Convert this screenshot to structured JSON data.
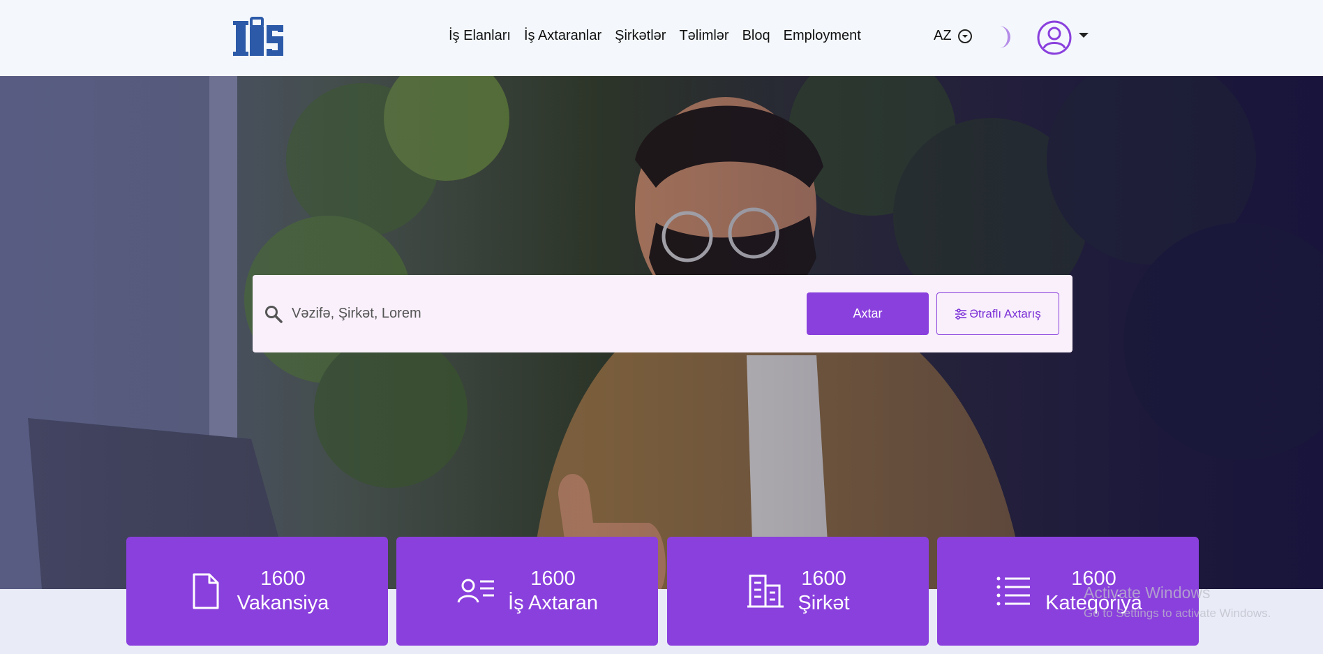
{
  "header": {
    "logo_alt": "İŞ",
    "nav": [
      "İş Elanları",
      "İş Axtaranlar",
      "Şirkətlər",
      "Təlimlər",
      "Bloq",
      "Employment"
    ],
    "language": "AZ"
  },
  "search": {
    "placeholder": "Vəzifə, Şirkət, Lorem",
    "search_button": "Axtar",
    "advanced_button": "Ətraflı Axtarış"
  },
  "stats": [
    {
      "count": "1600",
      "label": "Vakansiya",
      "icon": "document-icon"
    },
    {
      "count": "1600",
      "label": "İş Axtaran",
      "icon": "user-list-icon"
    },
    {
      "count": "1600",
      "label": "Şirkət",
      "icon": "building-icon"
    },
    {
      "count": "1600",
      "label": "Kateqoriya",
      "icon": "list-icon"
    }
  ],
  "watermark": {
    "title": "Activate Windows",
    "subtitle": "Go to Settings to activate Windows."
  },
  "colors": {
    "accent": "#8a40dd",
    "header_bg": "#f4f8fc",
    "search_bg": "#f9f0fb"
  }
}
